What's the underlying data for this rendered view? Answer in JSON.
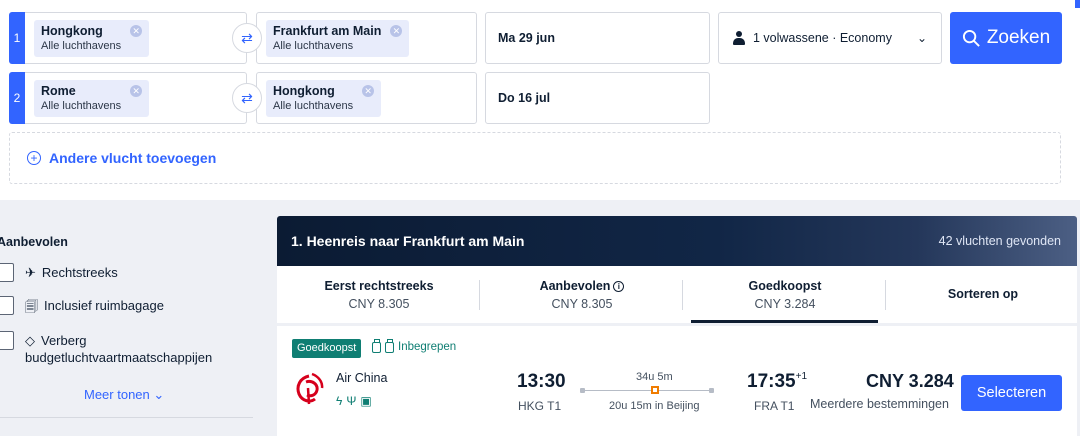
{
  "legs": [
    {
      "num": "1",
      "from_city": "Hongkong",
      "from_sub": "Alle luchthavens",
      "to_city": "Frankfurt am Main",
      "to_sub": "Alle luchthavens",
      "date": "Ma 29 jun"
    },
    {
      "num": "2",
      "from_city": "Rome",
      "from_sub": "Alle luchthavens",
      "to_city": "Hongkong",
      "to_sub": "Alle luchthavens",
      "date": "Do 16 jul"
    }
  ],
  "passengers": "1 volwassene · Economy",
  "search_label": "Zoeken",
  "add_flight": "Andere vlucht toevoegen",
  "filters": {
    "title": "Aanbevolen",
    "items": [
      "Rechtstreeks",
      "Inclusief ruimbagage",
      "Verberg",
      "budgetluchtvaartmaatschappijen"
    ],
    "more": "Meer tonen"
  },
  "results": {
    "title": "1. Heenreis naar Frankfurt am Main",
    "count": "42 vluchten gevonden",
    "sort_tabs": [
      {
        "label": "Eerst rechtstreeks",
        "price": "CNY 8.305"
      },
      {
        "label": "Aanbevolen",
        "price": "CNY 8.305"
      },
      {
        "label": "Goedkoopst",
        "price": "CNY 3.284"
      },
      {
        "label": "Sorteren op",
        "price": ""
      }
    ],
    "flight": {
      "badge": "Goedkoopst",
      "included": "Inbegrepen",
      "airline": "Air China",
      "dep_time": "13:30",
      "dep_airport": "HKG T1",
      "duration": "34u 5m",
      "layover": "20u 15m in Beijing",
      "arr_time": "17:35",
      "arr_plus": "+1",
      "arr_airport": "FRA T1",
      "price": "CNY 3.284",
      "price_note": "Meerdere bestemmingen",
      "select_label": "Selecteren"
    }
  },
  "colors": {
    "accent": "#3264ff",
    "green": "#0f7e73",
    "dark": "#0f1e32",
    "logo_red": "#d6001c"
  }
}
